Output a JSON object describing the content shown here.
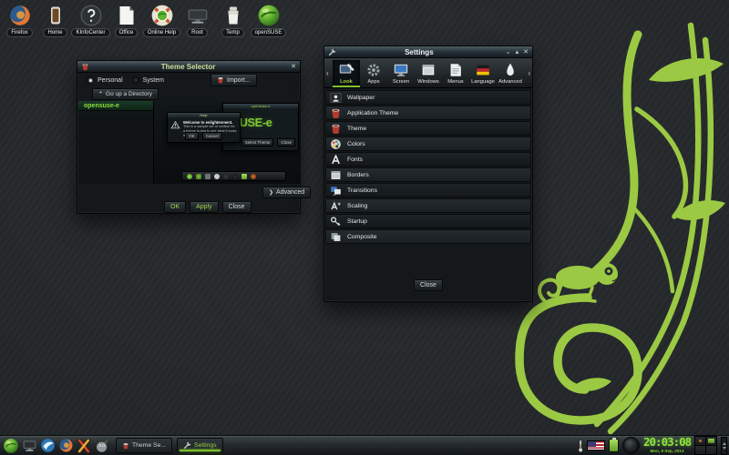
{
  "colors": {
    "accent_green": "#9bc943",
    "selection_green": "#9fd34a",
    "clock_green": "#8fe63c",
    "bucket_red": "#b23b2e",
    "window_bg": "#14181a"
  },
  "desktop": {
    "icons": [
      {
        "name": "firefox-icon",
        "label": "Firefox"
      },
      {
        "name": "home-icon",
        "label": "Home"
      },
      {
        "name": "kinfocenter-icon",
        "label": "KInfoCenter"
      },
      {
        "name": "office-icon",
        "label": "Office"
      },
      {
        "name": "online-help-icon",
        "label": "Online Help"
      },
      {
        "name": "root-icon",
        "label": "Root"
      },
      {
        "name": "temp-icon",
        "label": "Temp"
      },
      {
        "name": "opensuse-icon",
        "label": "openSUSE"
      }
    ]
  },
  "theme_selector": {
    "title": "Theme Selector",
    "personal_label": "Personal",
    "system_label": "System",
    "import_label": "Import...",
    "go_up_label": "Go up a Directory",
    "themes": [
      {
        "label": "opensuse-e"
      }
    ],
    "preview": {
      "window_title": "opensuse-e",
      "theme_text": "nSUSE-e",
      "select_theme_label": "Select Theme",
      "close_label": "Close",
      "dialog_title": "Help",
      "dialog_heading": "Welcome to enlightenment.",
      "dialog_body": "This is a sample set of content for a theme to test to see what it looks like.",
      "ok_label": "OK",
      "cancel_label": "Cancel"
    },
    "advanced_label": "Advanced",
    "ok_label": "OK",
    "apply_label": "Apply",
    "close_label": "Close"
  },
  "settings": {
    "title": "Settings",
    "tabs": [
      {
        "label": "Look",
        "icon": "look-icon",
        "selected": true
      },
      {
        "label": "Apps",
        "icon": "apps-gear-icon",
        "selected": false
      },
      {
        "label": "Screen",
        "icon": "screen-icon",
        "selected": false
      },
      {
        "label": "Windows",
        "icon": "windows-icon",
        "selected": false
      },
      {
        "label": "Menus",
        "icon": "menus-icon",
        "selected": false
      },
      {
        "label": "Language",
        "icon": "language-flag-icon",
        "selected": false
      },
      {
        "label": "Advanced",
        "icon": "advanced-droplet-icon",
        "selected": false
      }
    ],
    "items": [
      {
        "label": "Wallpaper",
        "icon": "wallpaper-icon"
      },
      {
        "label": "Application Theme",
        "icon": "paint-bucket-icon"
      },
      {
        "label": "Theme",
        "icon": "paint-bucket-icon"
      },
      {
        "label": "Colors",
        "icon": "palette-icon"
      },
      {
        "label": "Fonts",
        "icon": "fonts-icon"
      },
      {
        "label": "Borders",
        "icon": "window-border-icon"
      },
      {
        "label": "Transitions",
        "icon": "transitions-icon"
      },
      {
        "label": "Scaling",
        "icon": "scaling-icon"
      },
      {
        "label": "Startup",
        "icon": "key-icon"
      },
      {
        "label": "Composite",
        "icon": "layers-icon"
      }
    ],
    "close_label": "Close"
  },
  "taskbar": {
    "tasks": [
      {
        "label": "Theme Se...",
        "icon": "paint-bucket-icon",
        "active": false
      },
      {
        "label": "Settings",
        "icon": "wrench-icon",
        "active": true
      }
    ],
    "clock": {
      "time": "20:03:08",
      "date": "Mon, 9 Sep, 2013"
    }
  }
}
